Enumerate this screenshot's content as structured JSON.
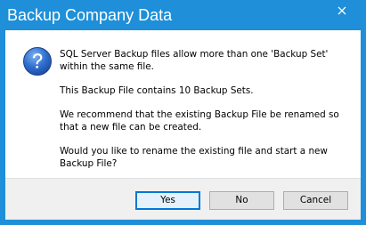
{
  "window": {
    "title": "Backup Company Data",
    "accent_color": "#1e8fd8",
    "close_icon": "close-icon"
  },
  "dialog": {
    "icon": "question-icon",
    "message_lines": [
      "SQL Server Backup files allow more than one 'Backup Set' within the same file.",
      "This Backup File contains 10 Backup Sets.",
      "We recommend that the existing Backup File be renamed so that a new file can be created.",
      "Would you like to rename the existing file and start a new Backup File?"
    ]
  },
  "buttons": {
    "yes_label": "Yes",
    "no_label": "No",
    "cancel_label": "Cancel",
    "default": "yes"
  }
}
